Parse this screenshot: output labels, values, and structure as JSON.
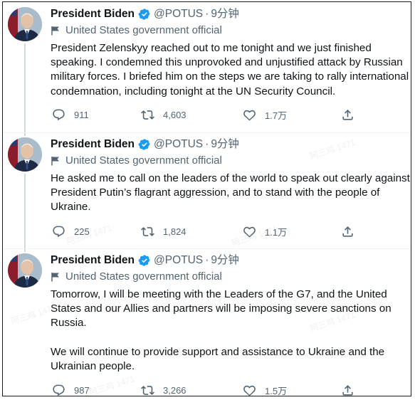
{
  "tweets": [
    {
      "name": "President Biden",
      "handle": "@POTUS",
      "sep": "·",
      "time": "9分钟",
      "label": "United States government official",
      "paragraphs": [
        "President Zelenskyy reached out to me tonight and we just finished speaking. I condemned this unprovoked and unjustified attack by Russian military forces. I briefed him on the steps we are taking to rally international condemnation, including tonight at the UN Security Council."
      ],
      "replies": "911",
      "retweets": "4,603",
      "likes": "1.7万"
    },
    {
      "name": "President Biden",
      "handle": "@POTUS",
      "sep": "·",
      "time": "9分钟",
      "label": "United States government official",
      "paragraphs": [
        "He asked me to call on the leaders of the world to speak out clearly against President Putin’s flagrant aggression, and to stand with the people of Ukraine."
      ],
      "replies": "225",
      "retweets": "1,824",
      "likes": "1.1万"
    },
    {
      "name": "President Biden",
      "handle": "@POTUS",
      "sep": "·",
      "time": "9分钟",
      "label": "United States government official",
      "paragraphs": [
        "Tomorrow, I will be meeting with the Leaders of the G7, and the United States and our Allies and partners will be imposing severe sanctions on Russia.",
        "We will continue to provide support and assistance to Ukraine and the Ukrainian people."
      ],
      "replies": "987",
      "retweets": "3,266",
      "likes": "1.5万"
    }
  ],
  "watermark": "阿三鸡 1471",
  "colors": {
    "verified": "#1d9bf0",
    "muted": "#536471",
    "text": "#0f1419"
  },
  "icons": [
    "verified-badge-icon",
    "flag-icon",
    "reply-icon",
    "retweet-icon",
    "like-icon",
    "share-icon"
  ]
}
